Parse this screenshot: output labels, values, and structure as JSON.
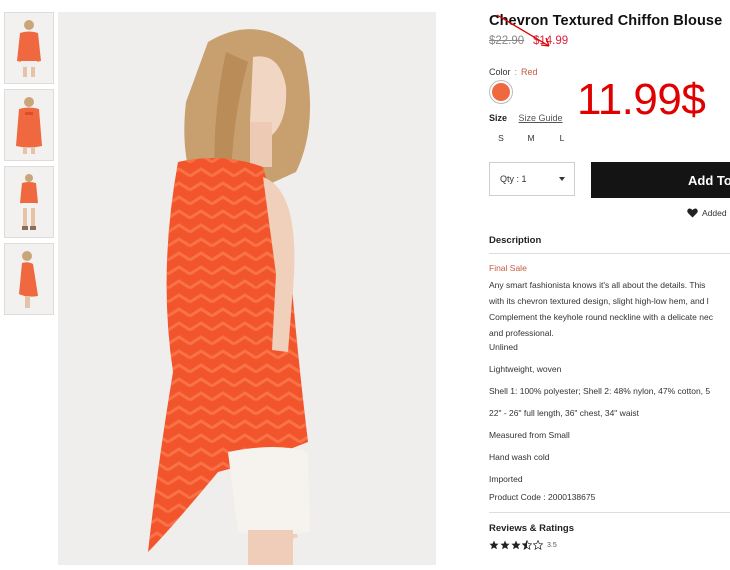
{
  "product": {
    "title": "Chevron Textured Chiffon Blouse",
    "price_original": "$22.90",
    "price_sale": "$14.99",
    "overlay_price": "11.99$"
  },
  "color": {
    "label": "Color",
    "separator": ":",
    "value": "Red",
    "swatch_hex": "#f0683f"
  },
  "size": {
    "label": "Size",
    "guide_label": "Size Guide",
    "options": [
      "S",
      "M",
      "L"
    ]
  },
  "quantity": {
    "text": "Qty : 1"
  },
  "cart": {
    "add_label": "Add To Bag",
    "added_label": "Added"
  },
  "description": {
    "heading": "Description",
    "final_sale": "Final Sale",
    "body_lines": [
      "Any smart fashionista knows it's all about the details. This",
      "with its chevron textured design, slight high-low hem, and l",
      "Complement the keyhole round neckline with a delicate nec",
      "and professional."
    ],
    "facts": [
      "Unlined",
      "Lightweight, woven",
      "Shell 1: 100% polyester; Shell 2: 48% nylon, 47% cotton, 5",
      "22\" - 26\" full length, 36\" chest, 34\" waist",
      "Measured from Small",
      "Hand wash cold",
      "Imported",
      "Product Code : 2000138675"
    ]
  },
  "reviews": {
    "heading": "Reviews & Ratings",
    "rating": 3.5,
    "rating_text": "3.5"
  },
  "colors": {
    "accent_red": "#e00000",
    "sale_red": "#e0213a",
    "final_sale": "#c85a3c",
    "button_bg": "#141414"
  }
}
